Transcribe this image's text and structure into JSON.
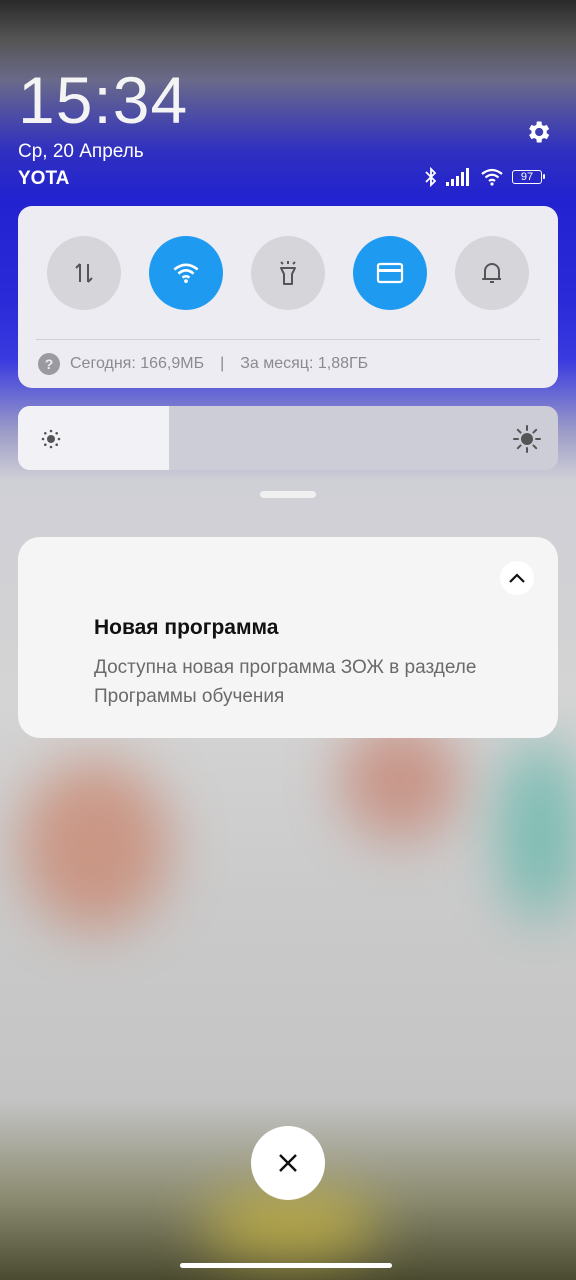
{
  "status": {
    "time": "15:34",
    "date": "Ср, 20 Апрель",
    "carrier": "YOTA",
    "battery_level": "97",
    "icons": [
      "bluetooth-icon",
      "signal-icon",
      "wifi-icon",
      "battery-icon"
    ]
  },
  "quick_settings": {
    "toggles": [
      {
        "name": "mobile-data",
        "icon": "mobile-data-arrows-icon",
        "on": false
      },
      {
        "name": "wifi",
        "icon": "wifi-icon",
        "on": true
      },
      {
        "name": "flashlight",
        "icon": "flashlight-icon",
        "on": false
      },
      {
        "name": "card",
        "icon": "card-icon",
        "on": true
      },
      {
        "name": "notifications",
        "icon": "bell-icon",
        "on": false
      }
    ],
    "data_usage": {
      "today": "Сегодня: 166,9МБ",
      "separator": "|",
      "month": "За месяц: 1,88ГБ"
    }
  },
  "brightness": {
    "level": 0.28
  },
  "notification": {
    "title": "Новая программа",
    "body": "Доступна новая программа ЗОЖ в разделе Программы обучения"
  },
  "colors": {
    "accent": "#1e9bf0",
    "toggle_off": "#d6d6da",
    "panel": "#ececf2"
  }
}
